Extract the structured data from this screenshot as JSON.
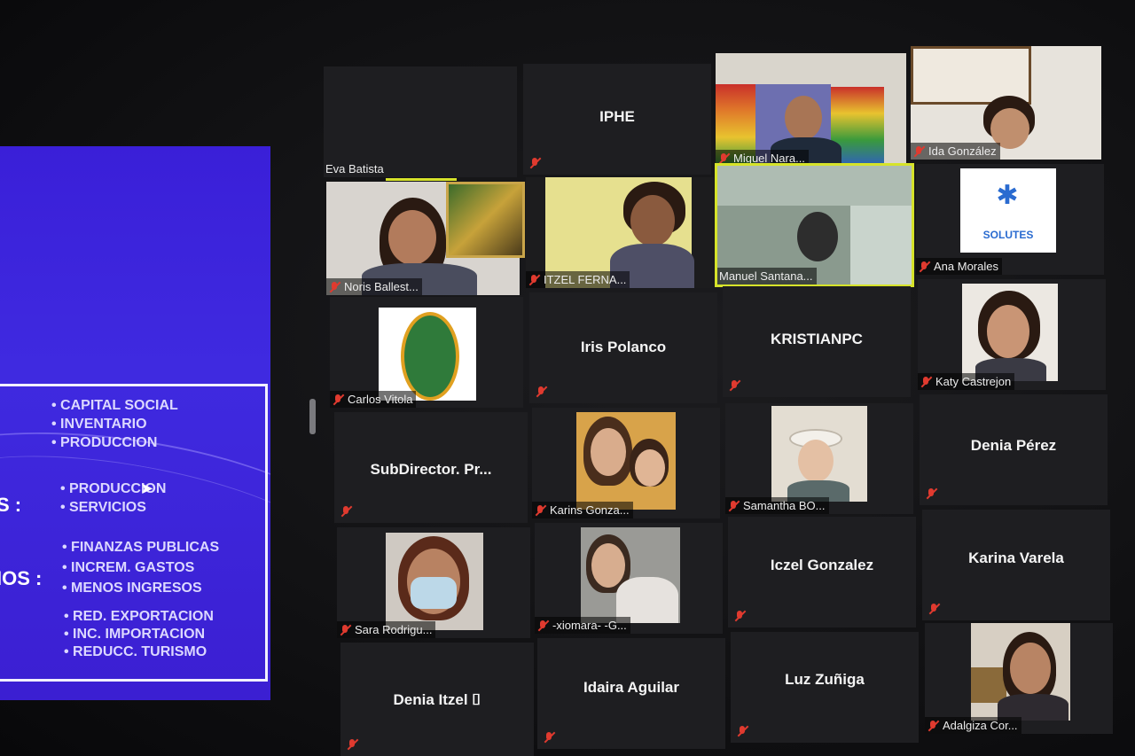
{
  "slide": {
    "group1": [
      "CAPITAL SOCIAL",
      "INVENTARIO",
      "PRODUCCION"
    ],
    "group2": [
      "PRODUCCION",
      "SERVICIOS"
    ],
    "group3": [
      "FINANZAS PUBLICAS",
      "INCREM. GASTOS",
      "MENOS INGRESOS"
    ],
    "group4": [
      "RED. EXPORTACION",
      "INC. IMPORTACION",
      "REDUCC. TURISMO"
    ],
    "label1": ":",
    "label2": "S :",
    "label3": "IOS :"
  },
  "participants": [
    {
      "id": "eva",
      "label": "Eva Batista",
      "muted": false
    },
    {
      "id": "iphe",
      "name": "IPHE",
      "muted": true
    },
    {
      "id": "miguel",
      "label": "Miguel Nara...",
      "muted": true
    },
    {
      "id": "ida",
      "label": "Ida González",
      "muted": true
    },
    {
      "id": "noris",
      "label": "Noris Ballest...",
      "muted": true
    },
    {
      "id": "itzel",
      "label": "ITZEL FERNA...",
      "muted": true
    },
    {
      "id": "manuel",
      "label": "Manuel Santana...",
      "muted": false,
      "active": true
    },
    {
      "id": "ana",
      "label": "Ana Morales",
      "muted": true,
      "logo": "SOLUTES"
    },
    {
      "id": "carlos",
      "label": "Carlos Vitola",
      "muted": true
    },
    {
      "id": "iris",
      "name": "Iris Polanco",
      "muted": true
    },
    {
      "id": "kristian",
      "name": "KRISTIANPC",
      "muted": true
    },
    {
      "id": "katy",
      "label": "Katy Castrejon",
      "muted": true
    },
    {
      "id": "subdirector",
      "name": "SubDirector.  Pr...",
      "muted": true
    },
    {
      "id": "karins",
      "label": "Karins Gonza...",
      "muted": true
    },
    {
      "id": "samantha",
      "label": "Samantha BO...",
      "muted": true
    },
    {
      "id": "deniap",
      "name": "Denia Pérez",
      "muted": true
    },
    {
      "id": "sara",
      "label": "Sara Rodrigu...",
      "muted": true
    },
    {
      "id": "xiomara",
      "label": "-xiomara- -G...",
      "muted": true
    },
    {
      "id": "iczel",
      "name": "Iczel Gonzalez",
      "muted": true
    },
    {
      "id": "karinav",
      "name": "Karina Varela",
      "muted": true
    },
    {
      "id": "deniai",
      "name": "Denia  Itzel ⌷",
      "muted": true
    },
    {
      "id": "idaira",
      "name": "Idaira Aguilar",
      "muted": true
    },
    {
      "id": "luz",
      "name": "Luz Zuñiga",
      "muted": true
    },
    {
      "id": "adalgiza",
      "label": "Adalgiza Cor...",
      "muted": true
    }
  ]
}
